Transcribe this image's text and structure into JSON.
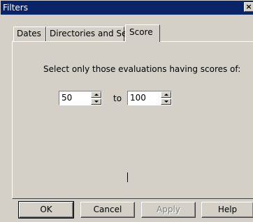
{
  "window": {
    "title": "Filters",
    "close_glyph": "×"
  },
  "tabs": [
    {
      "label": "Dates",
      "active": false
    },
    {
      "label": "Directories and Sets",
      "active": false
    },
    {
      "label": "Score",
      "active": true
    }
  ],
  "score": {
    "instruction": "Select only those evaluations having scores of:",
    "min_value": "50",
    "to_label": "to",
    "max_value": "100"
  },
  "buttons": {
    "ok": "OK",
    "cancel": "Cancel",
    "apply": "Apply",
    "help": "Help"
  },
  "colors": {
    "titlebar": "#0a246a",
    "face": "#d4d0c8"
  }
}
